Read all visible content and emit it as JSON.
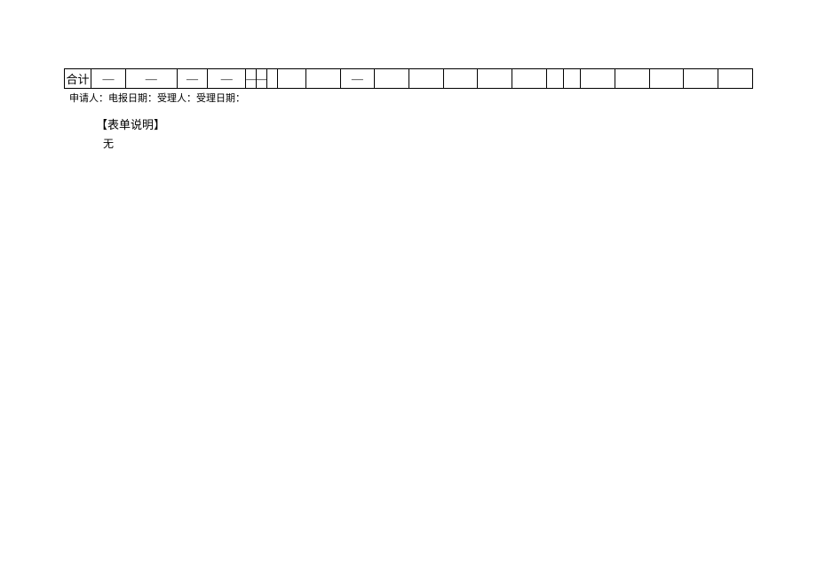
{
  "table": {
    "row_label": "合计",
    "cells": [
      "—",
      "—",
      "—",
      "—",
      "—",
      "—",
      "",
      "",
      "",
      "—",
      "",
      "",
      "",
      "",
      "",
      "",
      "",
      "",
      "",
      "",
      "",
      ""
    ]
  },
  "footer": {
    "applicant_label": "申请人：",
    "report_date_label": "电报日期：",
    "acceptor_label": "受理人：",
    "accept_date_label": "受理日期："
  },
  "note": {
    "title": "【表单说明】",
    "body": "无"
  }
}
